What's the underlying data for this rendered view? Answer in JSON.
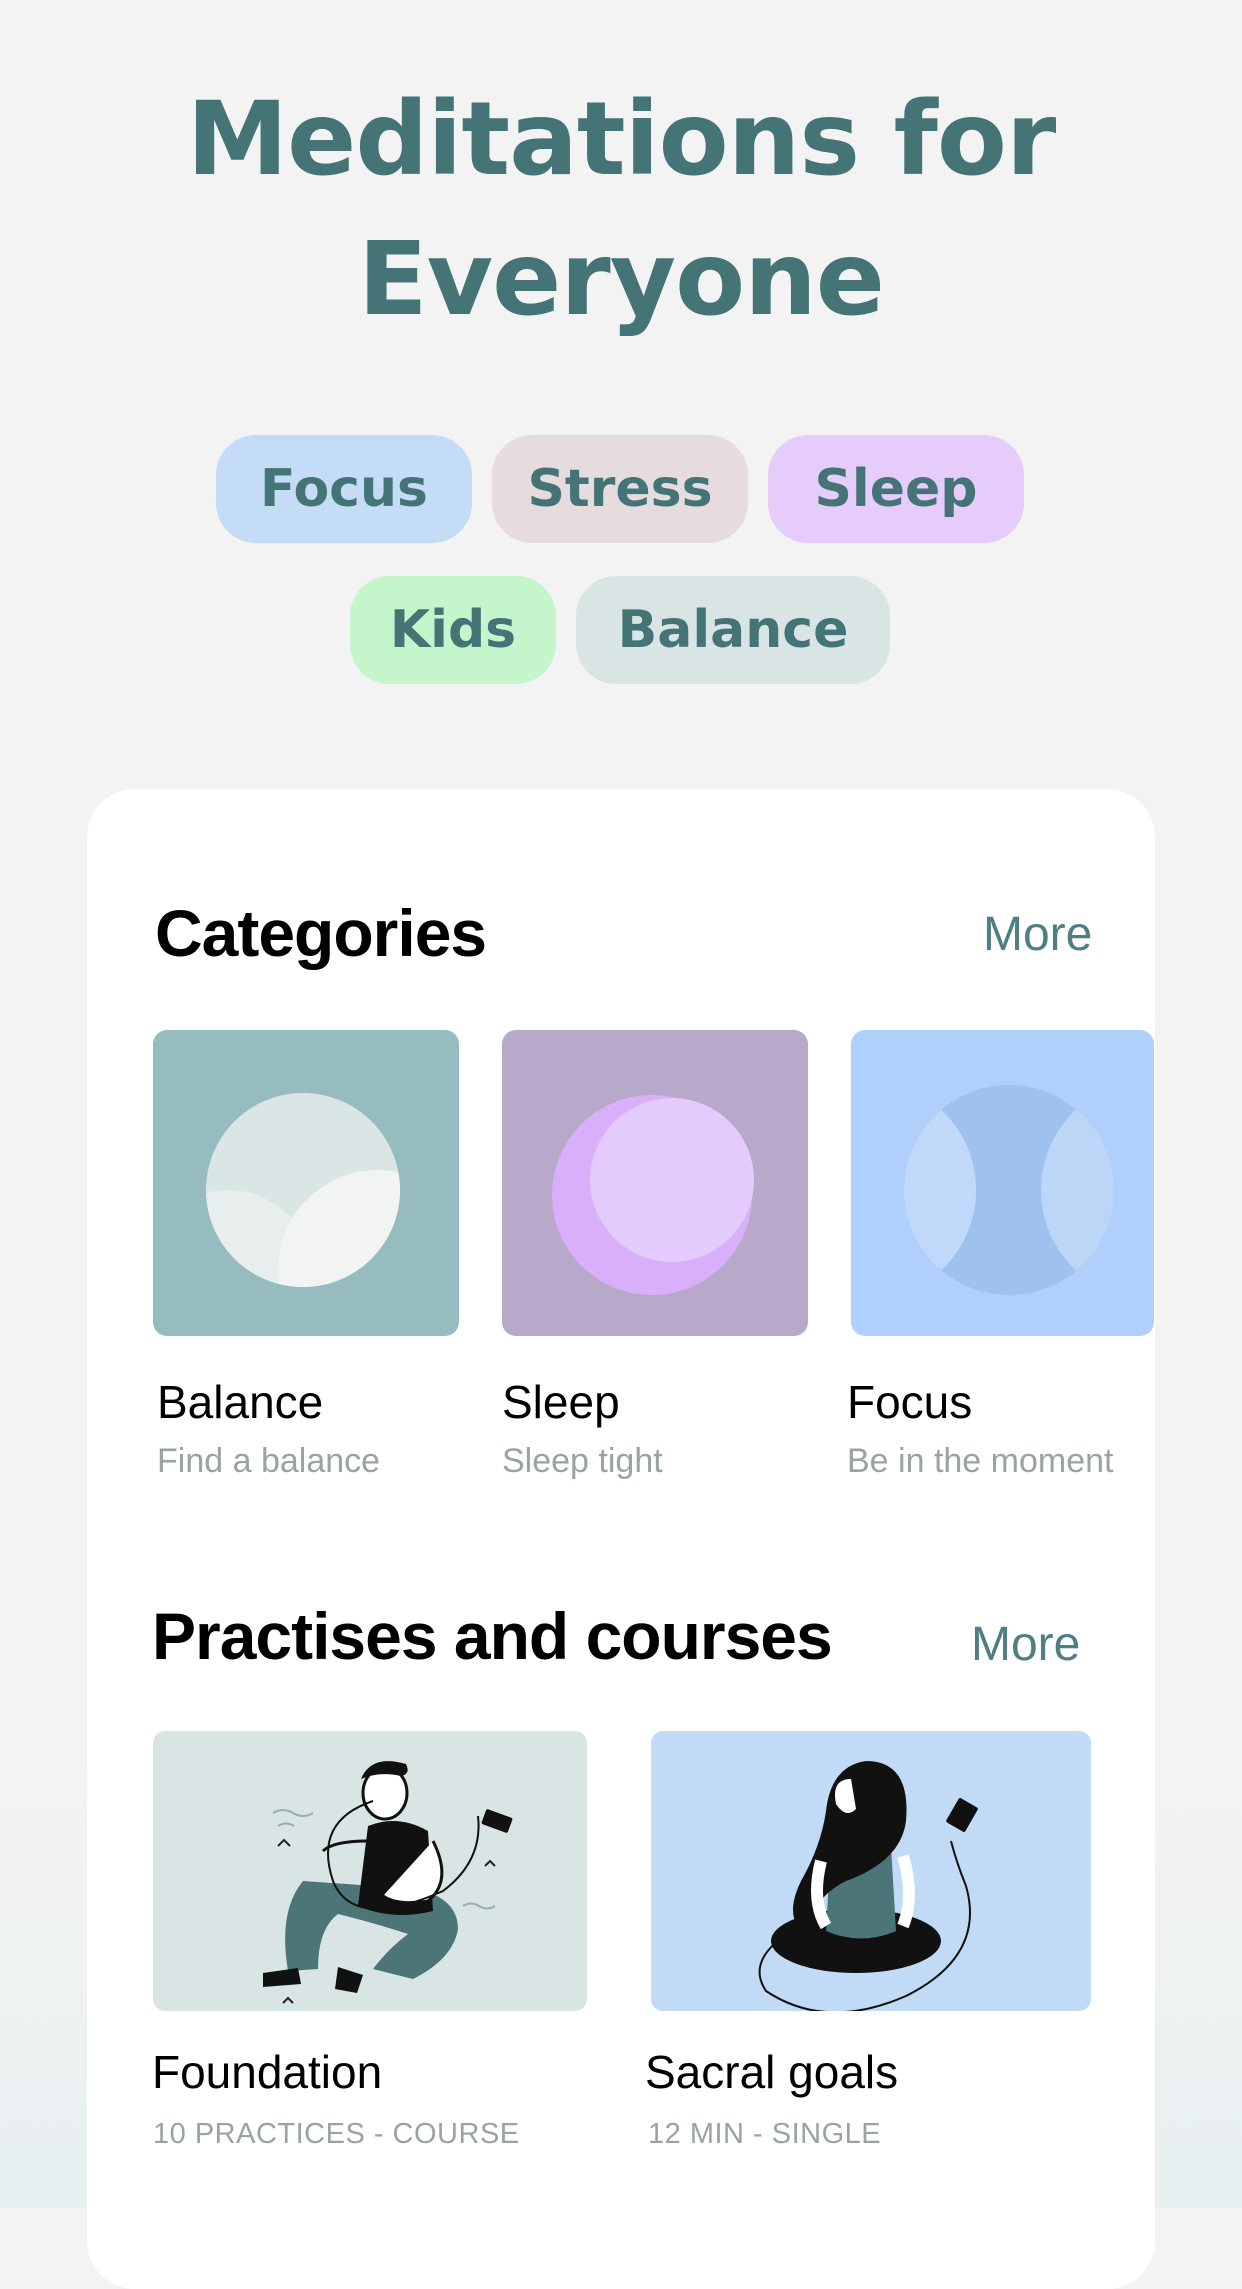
{
  "hero": {
    "title_line1": "Meditations for",
    "title_line2": "Everyone"
  },
  "tags": [
    {
      "label": "Focus",
      "color": "#c4dcf6"
    },
    {
      "label": "Stress",
      "color": "#e6dcde"
    },
    {
      "label": "Sleep",
      "color": "#e5ccfb"
    },
    {
      "label": "Kids",
      "color": "#c5f5cb"
    },
    {
      "label": "Balance",
      "color": "#d9e5e5"
    }
  ],
  "categories": {
    "title": "Categories",
    "more": "More",
    "items": [
      {
        "name": "Balance",
        "subtitle": "Find a balance",
        "color": "#96bcbf"
      },
      {
        "name": "Sleep",
        "subtitle": "Sleep tight",
        "color": "#b8a9ca"
      },
      {
        "name": "Focus",
        "subtitle": "Be in the moment",
        "color": "#b0cffb"
      }
    ]
  },
  "courses": {
    "title": "Practises and courses",
    "more": "More",
    "items": [
      {
        "name": "Foundation",
        "meta": "10 PRACTICES - COURSE",
        "color": "#d9e5e5"
      },
      {
        "name": "Sacral goals",
        "meta": "12 MIN - SINGLE",
        "color": "#c1dbf6"
      }
    ]
  }
}
